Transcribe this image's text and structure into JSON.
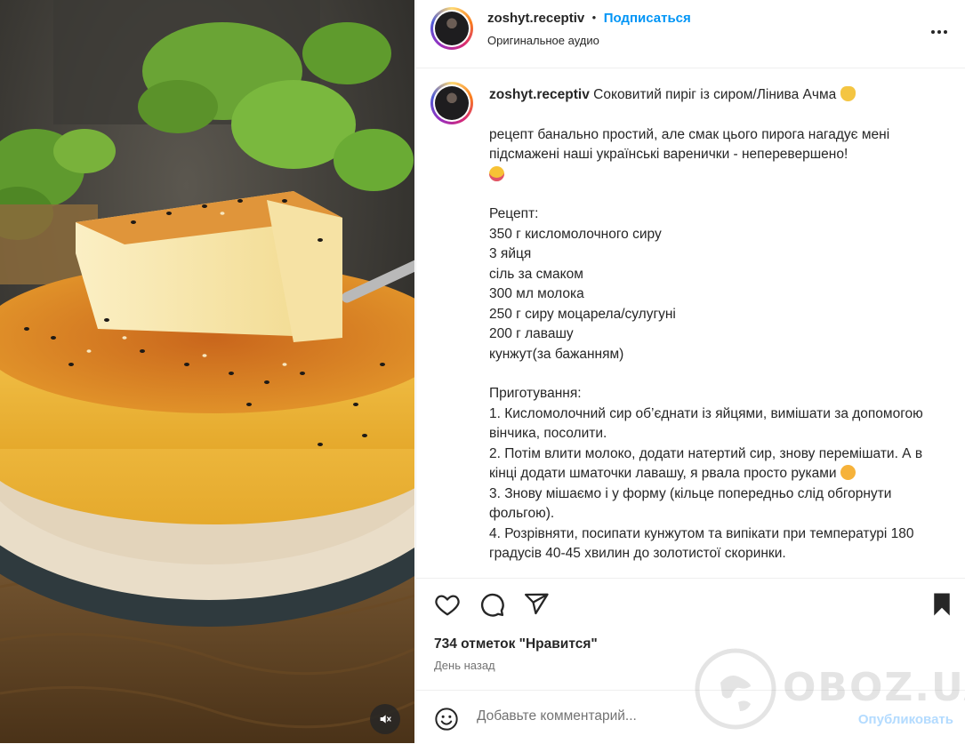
{
  "post": {
    "username": "zoshyt.receptiv",
    "separator": "•",
    "follow_label": "Подписаться",
    "audio_label": "Оригинальное аудио"
  },
  "caption": {
    "username": "zoshyt.receptiv",
    "title": "Соковитий пиріг із сиром/Лінива Ачма",
    "intro": "рецепт банально простий, але смак цього пирога нагадує мені підсмажені наші українські варенички - неперевершено!",
    "recipe_heading": "Рецепт:",
    "ingredients": [
      "350 г кисломолочного сиру",
      "3 яйця",
      "сіль за смаком",
      "300 мл молока",
      "250 г сиру моцарела/сулугуні",
      "200 г лавашу",
      "кунжут(за бажанням)"
    ],
    "steps_heading": "Приготування:",
    "step1": "1. Кисломолочний сир об’єднати із яйцями, вимішати за допомогою вінчика, посолити.",
    "step2": "2. Потім влити молоко, додати натертий сир, знову перемішати. А в кінці додати шматочки лавашу, я рвала просто руками",
    "step3": "3. Знову мішаємо і у форму (кільце попередньо слід обгорнути фольгою).",
    "step4": "4. Розрівняти, посипати кунжутом та випікати при температурі 180 градусів 40-45 хвилин до золотистої скоринки."
  },
  "icons": {
    "like": "heart-icon",
    "comment": "comment-bubble-icon",
    "share": "paper-plane-icon",
    "save": "bookmark-icon",
    "more": "more-options-icon",
    "emoji": "smiley-icon",
    "mute": "sound-off-icon"
  },
  "stats": {
    "likes": "734 отметок \"Нравится\"",
    "time": "День назад"
  },
  "comment": {
    "placeholder": "Добавьте комментарий...",
    "publish_label": "Опубликовать"
  },
  "watermark": {
    "text": "OBOZ.UA"
  },
  "colors": {
    "accent": "#0095f6",
    "publish_disabled": "#b3dbff",
    "text": "#262626",
    "secondary_text": "#737373"
  }
}
